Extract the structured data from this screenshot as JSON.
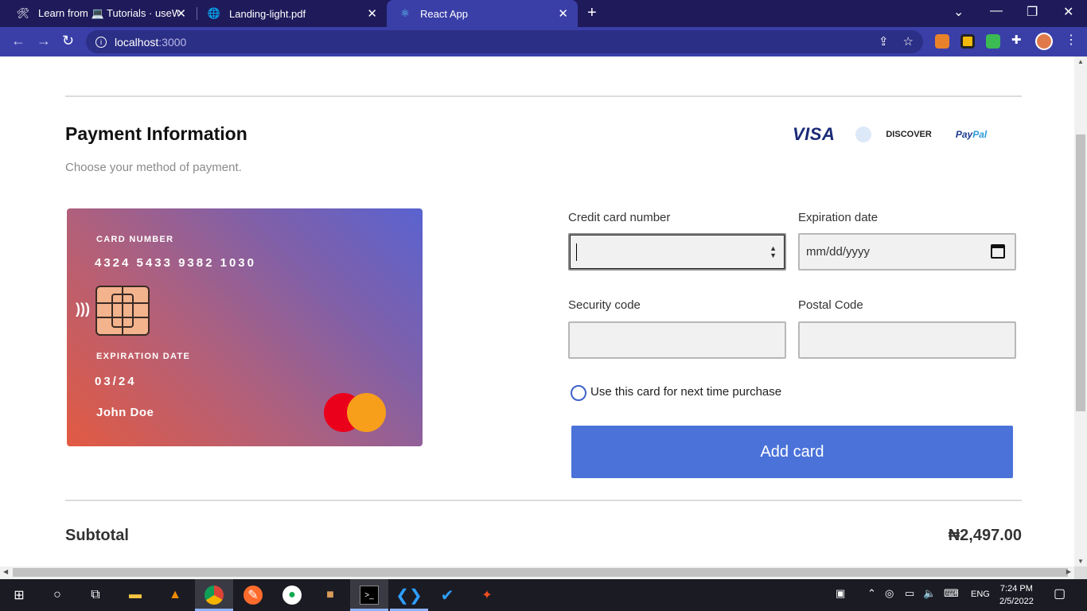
{
  "browser": {
    "tabs": [
      {
        "title": "Learn from 💻 Tutorials · useWeb",
        "icon": "tools-icon"
      },
      {
        "title": "Landing-light.pdf",
        "icon": "globe-icon"
      },
      {
        "title": "React App",
        "icon": "react-icon"
      }
    ],
    "url_host": "localhost",
    "url_port": ":3000"
  },
  "payment": {
    "title": "Payment Information",
    "subtitle": "Choose your method of payment.",
    "brands": {
      "visa": "VISA",
      "discover": "DISCOVER",
      "paypal_a": "Pay",
      "paypal_b": "Pal"
    }
  },
  "card": {
    "number_label": "CARD NUMBER",
    "number": "4324 5433 9382 1030",
    "exp_label": "EXPIRATION DATE",
    "exp": "03/24",
    "holder": "John Doe"
  },
  "form": {
    "card_number_label": "Credit card number",
    "card_number_value": "",
    "expiration_label": "Expiration date",
    "expiration_placeholder": "mm/dd/yyyy",
    "security_label": "Security code",
    "postal_label": "Postal Code",
    "remember_label": "Use this card for next time purchase",
    "remember_checked": false,
    "submit_label": "Add card"
  },
  "summary": {
    "subtotal_label": "Subtotal",
    "subtotal_value": "₦2,497.00"
  },
  "taskbar": {
    "language": "ENG",
    "time": "7:24 PM",
    "date": "2/5/2022"
  },
  "colors": {
    "accent": "#4a72d9",
    "browser_tabbar": "#1f1a5a",
    "browser_toolbar": "#3a3fa8"
  }
}
